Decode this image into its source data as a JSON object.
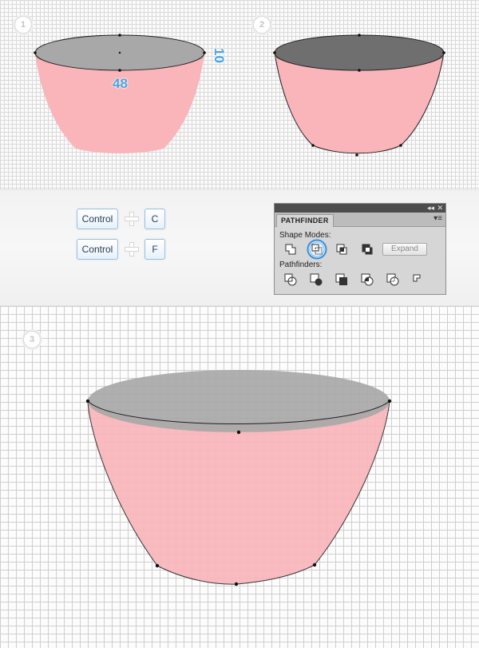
{
  "steps": {
    "step1_badge": "1",
    "step2_badge": "2",
    "step3_badge": "3"
  },
  "dimensions": {
    "width_label": "48",
    "height_label": "10",
    "label_color": "#4aa3e0"
  },
  "shortcuts": [
    {
      "modifier": "Control",
      "key": "C"
    },
    {
      "modifier": "Control",
      "key": "F"
    }
  ],
  "pathfinder_panel": {
    "tab_title": "PATHFINDER",
    "shape_modes_label": "Shape Modes:",
    "pathfinders_label": "Pathfinders:",
    "expand_label": "Expand",
    "shape_mode_icons": [
      "unite-icon",
      "minus-front-icon",
      "intersect-icon",
      "exclude-icon"
    ],
    "selected_shape_mode": "minus-front-icon",
    "pathfinder_icons": [
      "divide-icon",
      "trim-icon",
      "merge-icon",
      "crop-icon",
      "outline-icon",
      "minus-back-icon"
    ]
  },
  "colors": {
    "bowl_body": "#f9b5b9",
    "bowl_rim_light": "#a8a8a8",
    "bowl_rim_dark": "#6f6f6f",
    "highlight_ring": "#3a8fd6"
  }
}
